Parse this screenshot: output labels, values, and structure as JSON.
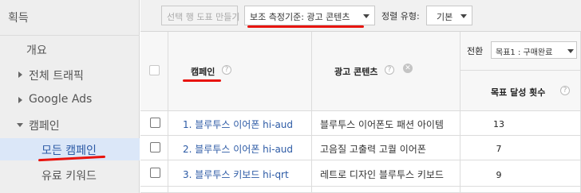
{
  "sidebar": {
    "header": "획득",
    "items": [
      {
        "label": "개요"
      },
      {
        "label": "전체 트래픽"
      },
      {
        "label": "Google Ads"
      },
      {
        "label": "캠페인"
      },
      {
        "label": "모든 캠페인"
      },
      {
        "label": "유료 키워드"
      }
    ]
  },
  "toolbar": {
    "create_table_button": "선택 행 도표 만들기",
    "secondary_dimension": "보조 측정기준: 광고 콘텐츠",
    "sort_type_label": "정렬 유형:",
    "sort_type_value": "기본"
  },
  "table": {
    "headers": {
      "campaign": "캠페인",
      "ad_content": "광고 콘텐츠",
      "conversion": "전환",
      "goal_select": "목표1 : 구매완료",
      "goal_completions": "목표 달성 횟수"
    },
    "help_glyph": "?",
    "remove_glyph": "✕",
    "rows": [
      {
        "campaign": "1. 블루투스 이어폰 hi-aud",
        "ad_content": "블루투스 이어폰도 패션 아이템",
        "goal_completions": "13"
      },
      {
        "campaign": "2. 블루투스 이어폰 hi-aud",
        "ad_content": "고음질 고출력 고퀄 이어폰",
        "goal_completions": "7"
      },
      {
        "campaign": "3. 블루투스 키보드 hi-qrt",
        "ad_content": "레트로 디자인 블루투스 키보드",
        "goal_completions": "9"
      }
    ]
  },
  "colors": {
    "highlight_underline": "#e8140e",
    "link": "#2c5aa5",
    "active_nav_bg": "#dbe7f8"
  }
}
